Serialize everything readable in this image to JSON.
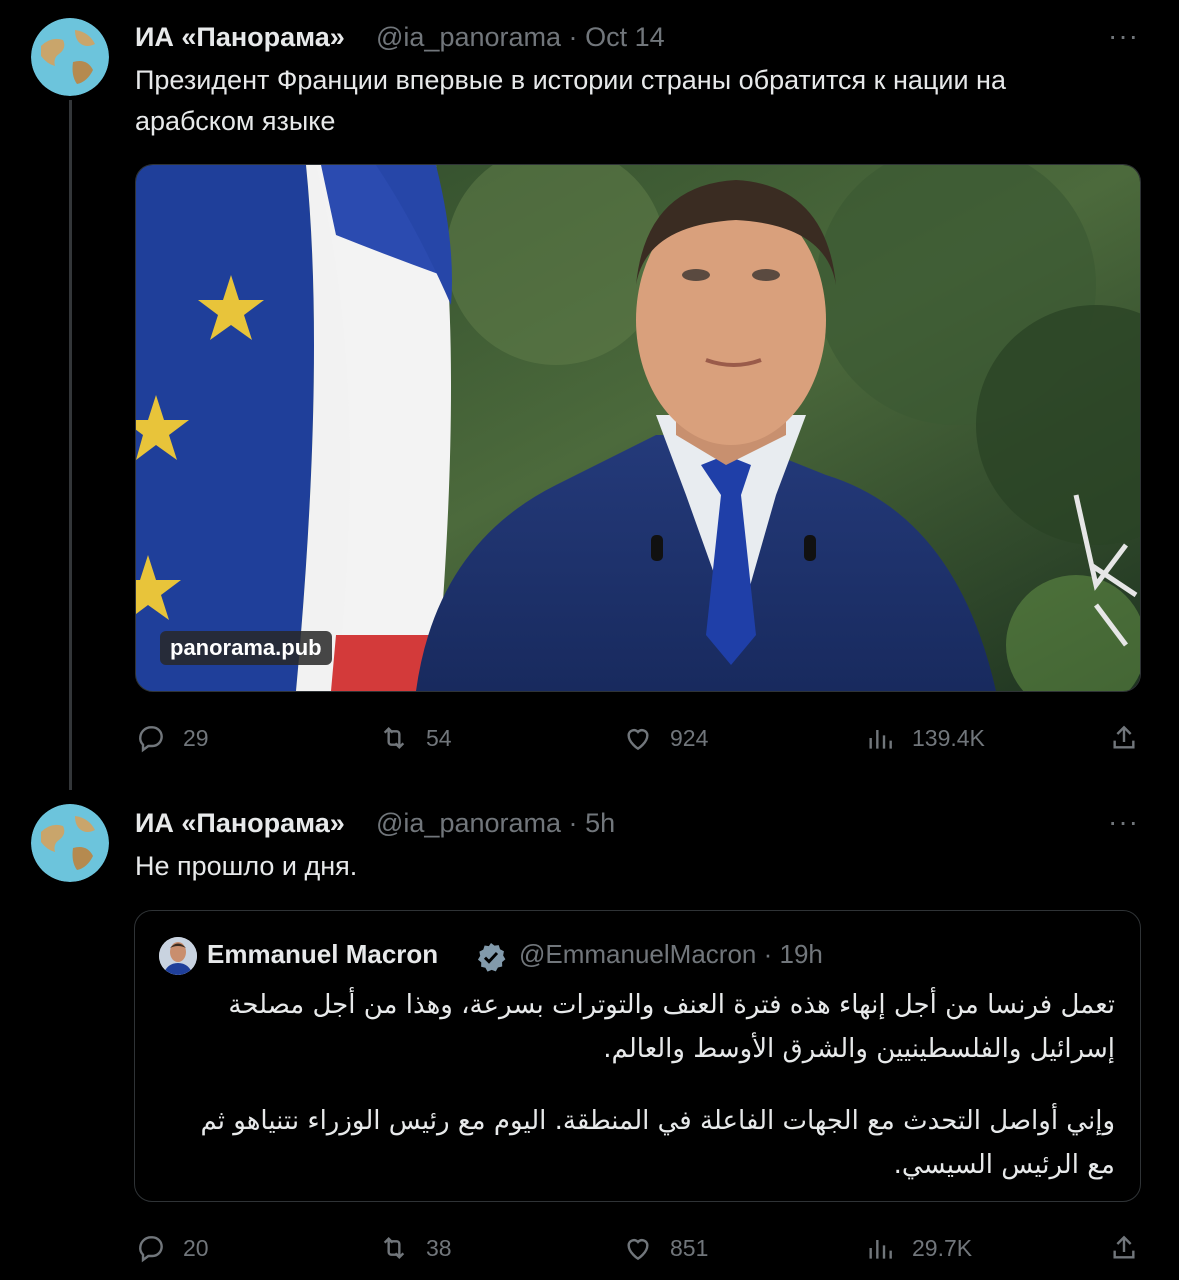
{
  "tweet1": {
    "name": "ИА «Панорама»",
    "handle": "@ia_panorama",
    "time": "Oct 14",
    "more": "···",
    "text": "Президент Франции впервые в истории страны обратится к нации на арабском языке",
    "media_watermark": "panorama.pub",
    "replies": "29",
    "reposts": "54",
    "likes": "924",
    "views": "139.4K"
  },
  "tweet2": {
    "name": "ИА «Панорама»",
    "handle": "@ia_panorama",
    "time": "5h",
    "more": "···",
    "text": "Не прошло и дня.",
    "replies": "20",
    "reposts": "38",
    "likes": "851",
    "views": "29.7K",
    "quote": {
      "name": "Emmanuel Macron",
      "handle": "@EmmanuelMacron",
      "time": "19h",
      "paragraph1": "تعمل فرنسا من أجل إنهاء هذه فترة العنف والتوترات بسرعة، وهذا من أجل مصلحة إسرائيل والفلسطينيين والشرق الأوسط والعالم.",
      "paragraph2": "وإني أواصل التحدث مع الجهات الفاعلة في المنطقة. اليوم مع رئيس الوزراء نتنياهو ثم مع الرئيس السيسي."
    }
  },
  "separator": "·",
  "colors": {
    "background": "#000000",
    "text": "#e7e9ea",
    "muted": "#71767b",
    "border": "#2f3336",
    "verified": "#829aab"
  }
}
